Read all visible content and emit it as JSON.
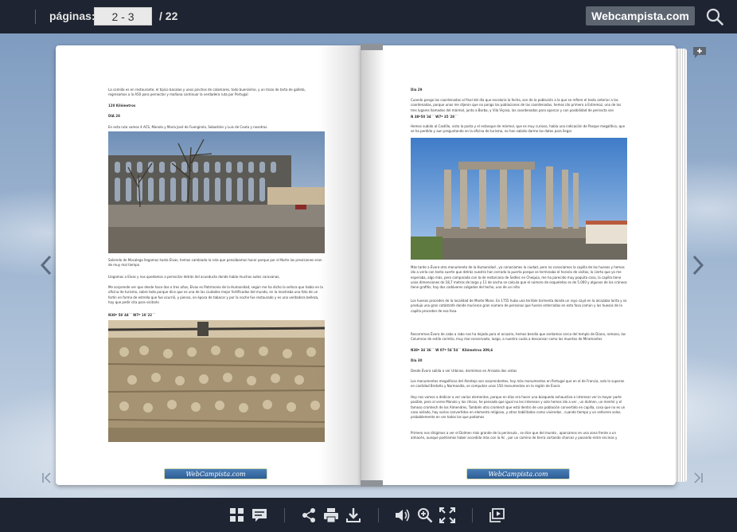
{
  "topbar": {
    "pages_label": "páginas:",
    "current_pages": "2 - 3",
    "total_pages": "/ 22",
    "brand": "Webcampista.com",
    "search_icon": "search-icon"
  },
  "left_page": {
    "p1": "La comida es en restaurante, el típico bacalao y unos pinchos de calamares, todo buenísimo, y un trozo de tarta de galleta, regresamos a la A50 para pernoctar y mañana continuar la verdadera ruta por Portugal",
    "p2": "120 Kilómetros",
    "p3": "DIA 28",
    "p4": "En esta ruta vamos 4 ACS, Manolo y María José de Fuengirola, Sebastián y Luis de Ceuta y nosotros.",
    "p5": "Saliendo de Mocalego llegamos hasta Elvas, hemos cambiado la ruta que pensábamos hacer porque por el Norte las previsiones eran de muy mal tiempo",
    "p6": "Llegamos a Elvas y nos quedamos a pernoctar detrás del acueducto donde había muchas autos caravanas,",
    "p7": "Me sorprende ver que desde hace dos o tres años, Elvas es Patrimonio de la Humanidad, según me ha dicho la señora que había en la oficina de turismo, sobre todo porque dice que es una de las ciudades mejor fortificadas del mundo, en la mostraba una foto de un fortín en forma de estrella que fue ocurrió, y pienso, en época de tabacar y por la noche fue restaurado y es una verdadera belleza, hay que pedir cita para visitarlo",
    "coords": "N38º 58´44´´        W7º 10´22´´",
    "banner": "WebCampista.com"
  },
  "right_page": {
    "p1": "Día 29",
    "p2": "Cuando pongo las coordenadas al final del día que escaloría la fecha, son de la población a la que se refiere el texto anterior a las coordenadas, porque unas me dijeron que no pongo las poblaciones de las coordenadas, hemos ido primero a Estremoz, uno de los tres lugares llamados del mármol, junto a Borba, y Vila Viçosa, las coordenadas para aparcar y con posibilidad de pernocta son",
    "coords1": "N 38º50´34´´         W7º 35´28´´",
    "p3": "Hemos subido al Castillo, visto la posta y el estanque de mármol, que es muy curioso, había una indicación de Parque megalítico, que se ha perdido y aun preguntando en la oficina de turismo, no han sabido darme los datos para llegar",
    "p4": "Más tarde a Évora otro monumento de la Humanidad , ya conocíamos la ciudad, pero no conocíamos la capilla de los huesos y hemos ido a verla con tanta suerte que detrás nuestra han cerrado la puerta porque se terminaba el horario de visitas, lo cierto que yo me esperaba, algo más, pero comparada con la de restorcano de Sedlec en Chequia, me ha parecido muy poquita cosa, la capilla tiene unas dimensiones de 18,7 metros de largo y 11 de ancho se calcula que el número de esqueletos es de 5.000 y algunos de los cráneos tiene grafitis, hay dos cadáveres colgados del techo, uno de un niño",
    "p5": "Los huesos proceden de la localidad de Monte Mono. En 1755 hubo una terrible tormenta donde un rayo cayó en la alcazaba lorita y se produjo una gran catástrofe donde murieron gran número de personas que fueron enterradas en esta fosa común y los huesos de la capilla proceden de esa fosa.",
    "p6": "Recorremos Évora de cabo a rabo nos ha dejado para el arcaziro, hemos bendio que sentamos cerca del templo de Diana, romano, las Columnas de estilo corintio, muy mal conservado, luego, a nuestra cuota a descansar como los muertos de Miramontes",
    "coords2": "N38º 34´36´´       W 07º 54´54´´    Kilómetros 309,6",
    "p7": "Día 30",
    "p8": "Desde Évora salida a ver Urbinos, dormimos en Arraiolo dos vistas",
    "p9": "Los monumentos megalíticos del Alentejo son sorprendentes, hay más monumentos en Portugal que en el de Francia, solo lo superan en cantidad Bretaña y Normandía, se computan unos 150 monumentos en la región de Évora",
    "p10": "Hoy nos vamos a dedicar a ver varios elementos, porque en días era hacer una búsqueda exhaustiva e interesar ver la mayor parte posible, pero al verse Manolo y los chicos, he pensado que igual no les interesan y solo hemos ido a ver , un dolmen, un menhir y el famoso cromlech de los Almendres, También otro cromlech que está dentro de una población convertido en capilla, cosa que no es un caso aislado, hay varios convertidos en elemento religioso, y otros habilitados como viviendas , cuando tiempo y un señorero solos, probablemente en ver todos los que podamos",
    "p11": "Primero nos dirigimos a ver el Dolmen más grande de la península , se dice que del mundo , aparcamos en una zona frente a un almacén, aunque podríamos haber accedido más con la Ac , por un camino de tierra cortando charcos y pasando entre encinas y",
    "banner": "WebCampista.com"
  },
  "bottombar": {
    "icons": [
      "grid-view-icon",
      "comment-icon",
      "share-icon",
      "print-icon",
      "download-icon",
      "sound-icon",
      "zoom-in-icon",
      "fullscreen-icon",
      "gallery-icon"
    ]
  }
}
